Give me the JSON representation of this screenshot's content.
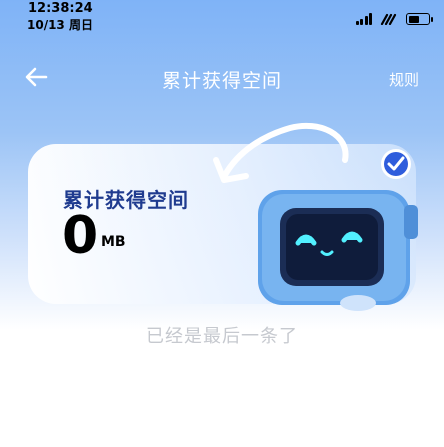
{
  "status_bar": {
    "time": "12:38:24",
    "date": "10/13 周日",
    "battery_level": 0.55
  },
  "nav": {
    "title": "累计获得空间",
    "rules_label": "规则"
  },
  "card": {
    "title": "累计获得空间",
    "value": "0",
    "unit": "MB"
  },
  "footer": {
    "text": "已经是最后一条了"
  },
  "colors": {
    "accent": "#1f3b8f",
    "header_bg": "#7fb3f7",
    "check_badge": "#2f5ddc"
  }
}
